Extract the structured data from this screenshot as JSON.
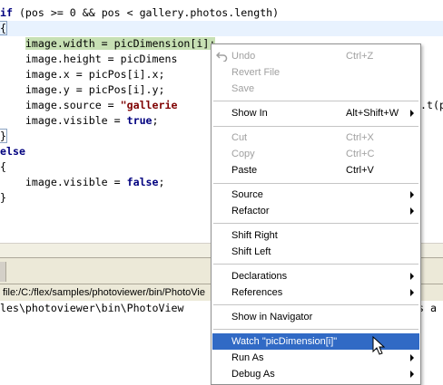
{
  "editor": {
    "lines": [
      {
        "tokens": [
          {
            "t": "if",
            "kw": true
          },
          {
            "t": " (pos >= 0 && pos < gallery.photos.length)"
          }
        ]
      },
      {
        "tokens": [
          {
            "t": "{"
          }
        ]
      },
      {
        "tokens": [
          {
            "t": "    "
          },
          {
            "t": "image.width = picDimension[i];",
            "sel": true
          }
        ]
      },
      {
        "tokens": [
          {
            "t": "    image.height = picDimens"
          }
        ]
      },
      {
        "tokens": [
          {
            "t": "    image.x = picPos[i].x;"
          }
        ]
      },
      {
        "tokens": [
          {
            "t": "    image.y = picPos[i].y;"
          }
        ]
      },
      {
        "tokens": [
          {
            "t": "    image.source = "
          },
          {
            "t": "\"gallerie",
            "str": true
          }
        ]
      },
      {
        "tokens": [
          {
            "t": "    image.visible = "
          },
          {
            "t": "true",
            "kw": true
          },
          {
            "t": ";"
          }
        ]
      },
      {
        "tokens": [
          {
            "t": "}"
          }
        ]
      },
      {
        "tokens": [
          {
            "t": "else",
            "kw": true
          }
        ]
      },
      {
        "tokens": [
          {
            "t": "{"
          }
        ]
      },
      {
        "tokens": [
          {
            "t": "    image.visible = "
          },
          {
            "t": "false",
            "kw": true
          },
          {
            "t": ";"
          }
        ]
      },
      {
        "tokens": [
          {
            "t": "}"
          }
        ]
      }
    ],
    "overflow_right": ".t(p"
  },
  "path_bar": {
    "text": "file:/C:/flex/samples/photoviewer/bin/PhotoVie"
  },
  "console": {
    "line_left": "les\\photoviewer\\bin\\PhotoView",
    "line_right": "s a"
  },
  "context_menu": {
    "items": [
      {
        "label": "Undo",
        "shortcut": "Ctrl+Z",
        "disabled": true,
        "icon": "undo-icon"
      },
      {
        "label": "Revert File",
        "disabled": true
      },
      {
        "label": "Save",
        "disabled": true
      },
      {
        "label": "Show In",
        "shortcut": "Alt+Shift+W",
        "submenu": true
      },
      {
        "label": "Cut",
        "shortcut": "Ctrl+X",
        "disabled": true
      },
      {
        "label": "Copy",
        "shortcut": "Ctrl+C",
        "disabled": true
      },
      {
        "label": "Paste",
        "shortcut": "Ctrl+V"
      },
      {
        "label": "Source",
        "submenu": true
      },
      {
        "label": "Refactor",
        "submenu": true
      },
      {
        "label": "Shift Right"
      },
      {
        "label": "Shift Left"
      },
      {
        "label": "Declarations",
        "submenu": true
      },
      {
        "label": "References",
        "submenu": true
      },
      {
        "label": "Show in Navigator"
      },
      {
        "label": "Watch \"picDimension[i]\"",
        "highlighted": true
      },
      {
        "label": "Run As",
        "submenu": true
      },
      {
        "label": "Debug As",
        "submenu": true
      }
    ]
  },
  "colors": {
    "keyword": "#00007f",
    "string": "#7f0000",
    "selection": "#c7e0b4",
    "current_line": "#e8f2fe",
    "menu_highlight": "#316ac5",
    "disabled_text": "#a0a0a0"
  }
}
